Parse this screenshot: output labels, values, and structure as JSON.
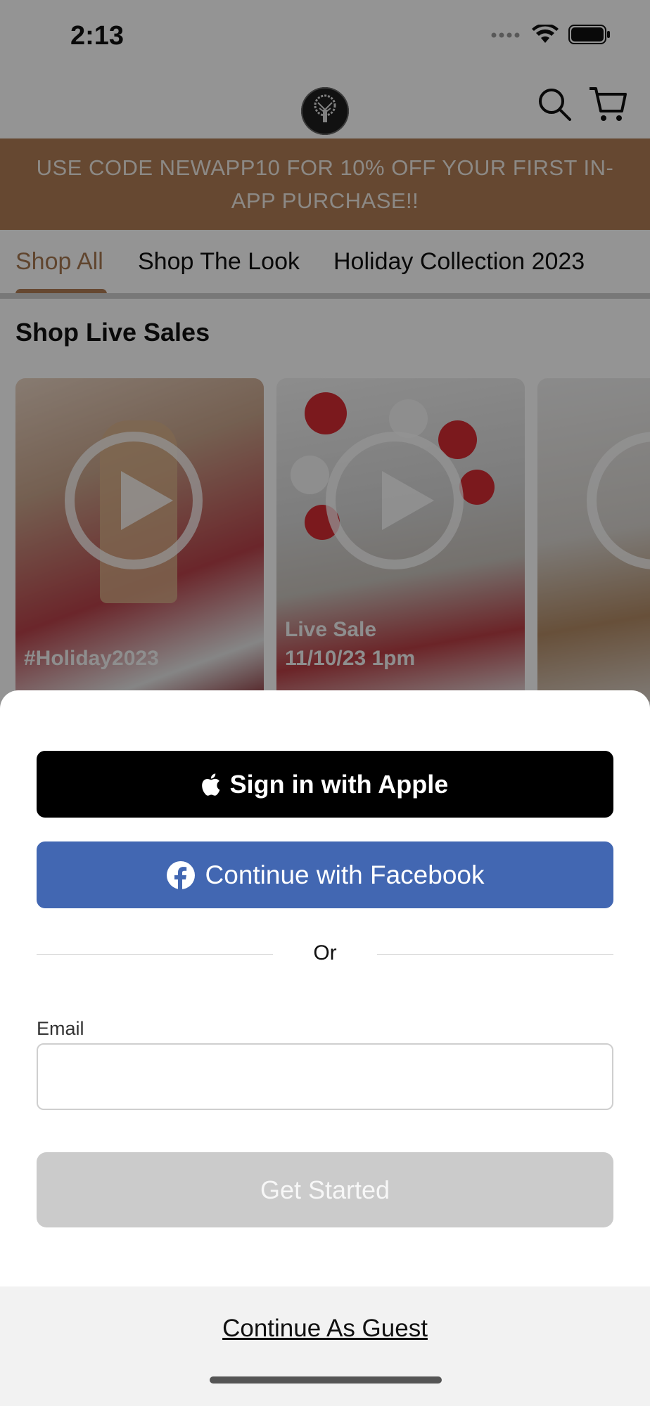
{
  "status_bar": {
    "time": "2:13"
  },
  "header": {
    "logo_icon": "tree-logo-icon",
    "search_icon": "search-icon",
    "cart_icon": "cart-icon"
  },
  "promo_banner": {
    "text": "USE CODE NEWAPP10 FOR 10% OFF YOUR FIRST IN-APP PURCHASE!!"
  },
  "tabs": [
    {
      "label": "Shop All",
      "active": true
    },
    {
      "label": "Shop The Look",
      "active": false
    },
    {
      "label": "Holiday Collection 2023",
      "active": false
    }
  ],
  "section": {
    "title": "Shop Live Sales"
  },
  "videos": [
    {
      "label_line1": "#Holiday2023",
      "label_line2": ""
    },
    {
      "label_line1": "Live Sale",
      "label_line2": "11/10/23 1pm"
    },
    {
      "label_line1": "",
      "label_line2": ""
    }
  ],
  "auth_sheet": {
    "apple_button": "Sign in with Apple",
    "facebook_button": "Continue with Facebook",
    "divider_text": "Or",
    "email_label": "Email",
    "email_value": "",
    "get_started_button": "Get Started",
    "guest_link": "Continue As Guest"
  },
  "colors": {
    "promo_bg": "#b07d55",
    "apple_bg": "#000000",
    "facebook_bg": "#4267b2",
    "disabled_button": "#cbcbcb"
  }
}
